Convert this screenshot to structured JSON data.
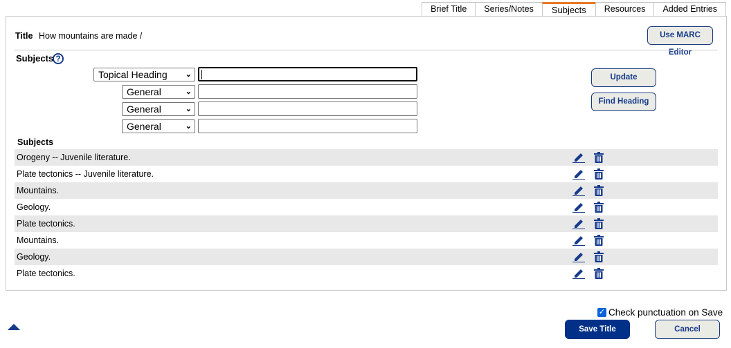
{
  "tabs": [
    "Brief Title",
    "Series/Notes",
    "Subjects",
    "Resources",
    "Added Entries"
  ],
  "active_tab": "Subjects",
  "title_label": "Title",
  "title_value": "How mountains are made /",
  "marc_button": "Use MARC Editor",
  "subjects_label": "Subjects",
  "help_icon": "?",
  "heading_type": "Topical Heading",
  "subdivisions": [
    "General",
    "General",
    "General"
  ],
  "update_button": "Update",
  "find_heading_button": "Find Heading",
  "subjects_list_label": "Subjects",
  "subjects": [
    "Orogeny -- Juvenile literature.",
    "Plate tectonics -- Juvenile literature.",
    "Mountains.",
    "Geology.",
    "Plate tectonics.",
    "Mountains.",
    "Geology.",
    "Plate tectonics."
  ],
  "check_punctuation": {
    "label": "Check punctuation on Save",
    "checked": true
  },
  "save_button": "Save Title",
  "cancel_button": "Cancel",
  "colors": {
    "accent": "#e87722",
    "primary": "#003087",
    "row_alt": "#e8e8e8"
  }
}
